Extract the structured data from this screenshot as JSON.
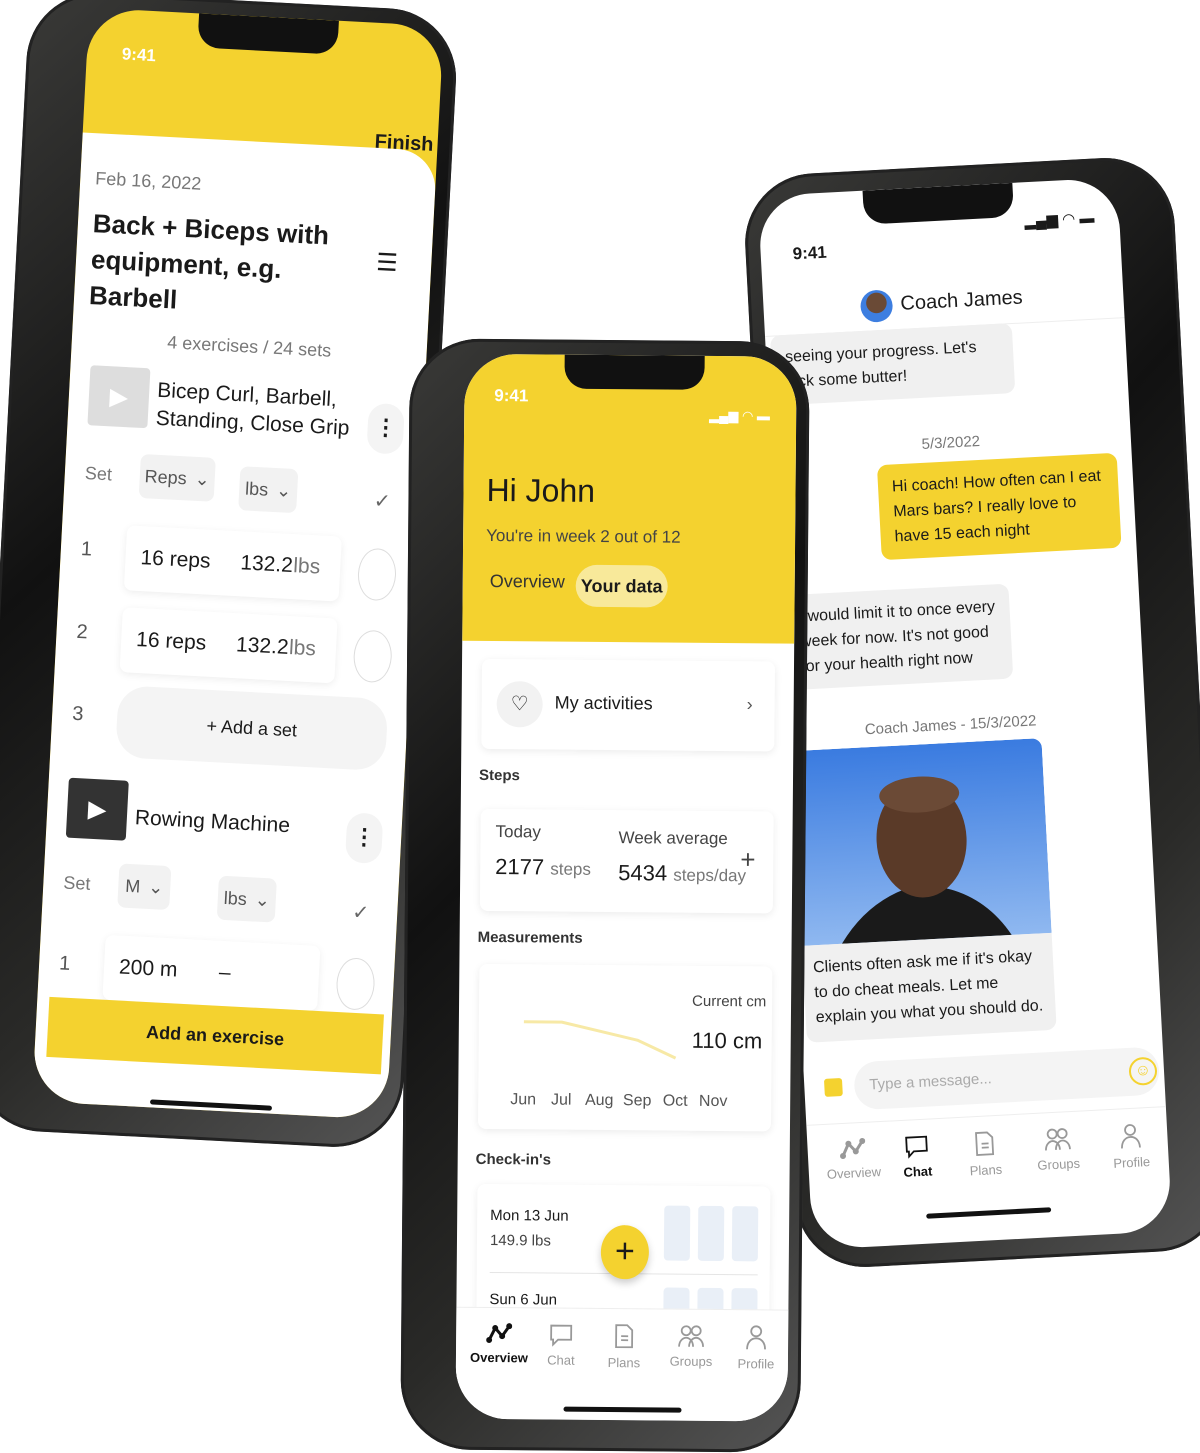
{
  "colors": {
    "accent": "#f4d22f",
    "text": "#1a1a1a",
    "muted": "#777"
  },
  "status": {
    "time": "9:41"
  },
  "workout": {
    "finish": "Finish",
    "date": "Feb 16, 2022",
    "title_line1": "Back + Biceps with",
    "title_line2": "equipment, e.g. Barbell",
    "summary": "4 exercises / 24 sets",
    "exercise1": {
      "name_line1": "Bicep Curl, Barbell,",
      "name_line2": "Standing, Close Grip",
      "set_label": "Set",
      "reps_select": "Reps",
      "unit_select": "lbs",
      "sets": [
        {
          "num": "1",
          "reps": "16 reps",
          "weight": "132.2",
          "unit": "lbs"
        },
        {
          "num": "2",
          "reps": "16 reps",
          "weight": "132.2",
          "unit": "lbs"
        }
      ],
      "next_num": "3",
      "add_set": "+ Add a set"
    },
    "exercise2": {
      "name": "Rowing Machine",
      "set_label": "Set",
      "dist_select": "M",
      "unit_select": "lbs",
      "sets": [
        {
          "num": "1",
          "distance": "200 m",
          "weight": "–"
        }
      ]
    },
    "add_exercise": "Add an exercise"
  },
  "overview": {
    "greeting": "Hi John",
    "subtitle": "You're in week 2 out of 12",
    "tabs": [
      {
        "label": "Overview",
        "active": false
      },
      {
        "label": "Your data",
        "active": true
      }
    ],
    "activities": "My activities",
    "steps_heading": "Steps",
    "today_label": "Today",
    "today_value": "2177",
    "today_unit": "steps",
    "week_label": "Week average",
    "week_value": "5434",
    "week_unit": "steps/day",
    "measurements_heading": "Measurements",
    "current_label": "Current cm",
    "current_value": "110 cm",
    "checkins_heading": "Check-in's",
    "checkins": [
      {
        "date": "Mon 13 Jun",
        "value": "149.9 lbs"
      },
      {
        "date": "Sun 6 Jun",
        "value": ""
      }
    ]
  },
  "chart_data": {
    "type": "line",
    "categories": [
      "Jun",
      "Jul",
      "Aug",
      "Sep",
      "Oct",
      "Nov"
    ],
    "series": [
      {
        "values": [
          112,
          112,
          111.5,
          111,
          110,
          null
        ]
      }
    ],
    "xlabel": "",
    "ylabel": "",
    "grid": false,
    "color": "#f7e9a6"
  },
  "chat": {
    "coach_name": "Coach James",
    "messages": [
      {
        "from": "coach",
        "text": "seeing your progress. Let's kick some butter!"
      },
      {
        "type": "date",
        "text": "5/3/2022"
      },
      {
        "from": "user",
        "text": "Hi coach! How often can I eat Mars bars? I really love to have 15 each night"
      },
      {
        "from": "coach",
        "text": "I would limit it to once every week for now. It's not good for your health right now"
      },
      {
        "type": "date",
        "text": "Coach James - 15/3/2022"
      },
      {
        "from": "coach",
        "type": "image",
        "text": "Clients often ask me if it's okay to do cheat meals. Let me explain you what you should do."
      }
    ],
    "input_placeholder": "Type a message..."
  },
  "nav": {
    "items": [
      {
        "label": "Overview",
        "icon": "overview-icon"
      },
      {
        "label": "Chat",
        "icon": "chat-icon"
      },
      {
        "label": "Plans",
        "icon": "plans-icon"
      },
      {
        "label": "Groups",
        "icon": "groups-icon"
      },
      {
        "label": "Profile",
        "icon": "profile-icon"
      }
    ]
  }
}
